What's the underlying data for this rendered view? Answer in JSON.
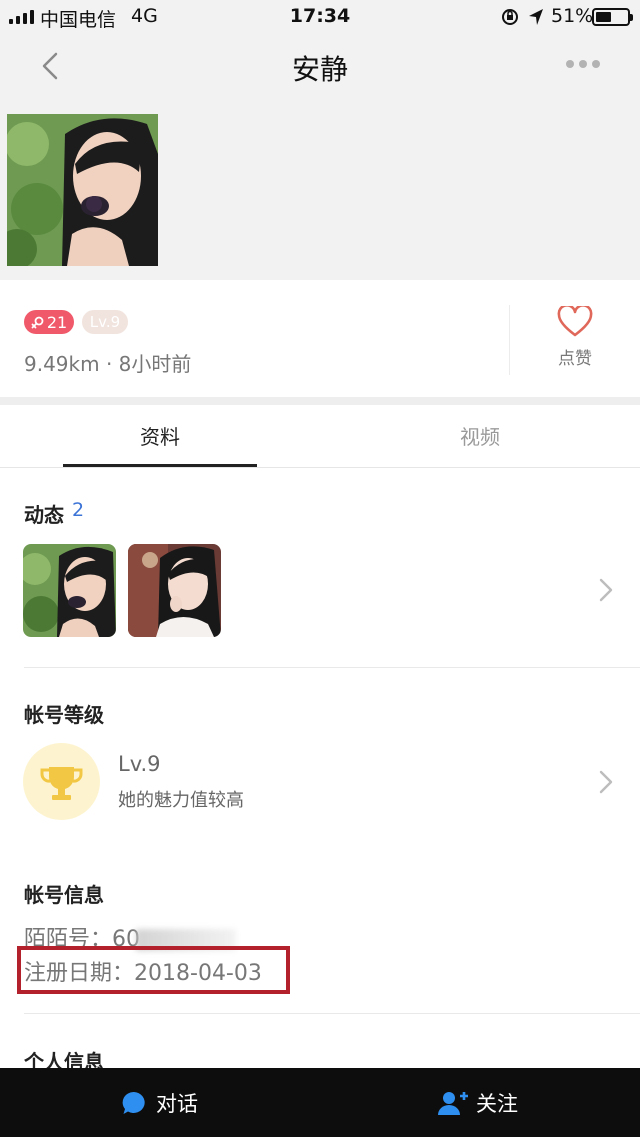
{
  "status_bar": {
    "carrier": "中国电信",
    "network": "4G",
    "time": "17:34",
    "battery": "51%",
    "battery_level": 0.51
  },
  "nav": {
    "title": "安静",
    "back_icon": "chevron-left-icon",
    "more_icon": "more-dots-icon"
  },
  "profile": {
    "age": "21",
    "level_badge": "Lv.9",
    "distance_time": "9.49km · 8小时前",
    "like_label": "点赞",
    "like_icon": "heart-outline-icon"
  },
  "tabs": [
    {
      "label": "资料",
      "active": true
    },
    {
      "label": "视频",
      "active": false
    }
  ],
  "moments": {
    "title": "动态",
    "count": "2"
  },
  "account_level": {
    "title": "帐号等级",
    "level": "Lv.9",
    "description": "她的魅力值较高",
    "icon": "trophy-icon"
  },
  "account_info": {
    "title": "帐号信息",
    "momo_id_label": "陌陌号：",
    "momo_id_visible": "60",
    "reg_date_label": "注册日期：",
    "reg_date": "2018-04-03"
  },
  "personal_info": {
    "title": "个人信息"
  },
  "bottom_bar": {
    "chat_label": "对话",
    "follow_label": "关注"
  },
  "colors": {
    "accent_red": "#f0596a",
    "link_blue": "#3b73d6",
    "highlight_box": "#b3212c",
    "trophy_bg": "#fdf4cf",
    "trophy": "#f2c744"
  }
}
